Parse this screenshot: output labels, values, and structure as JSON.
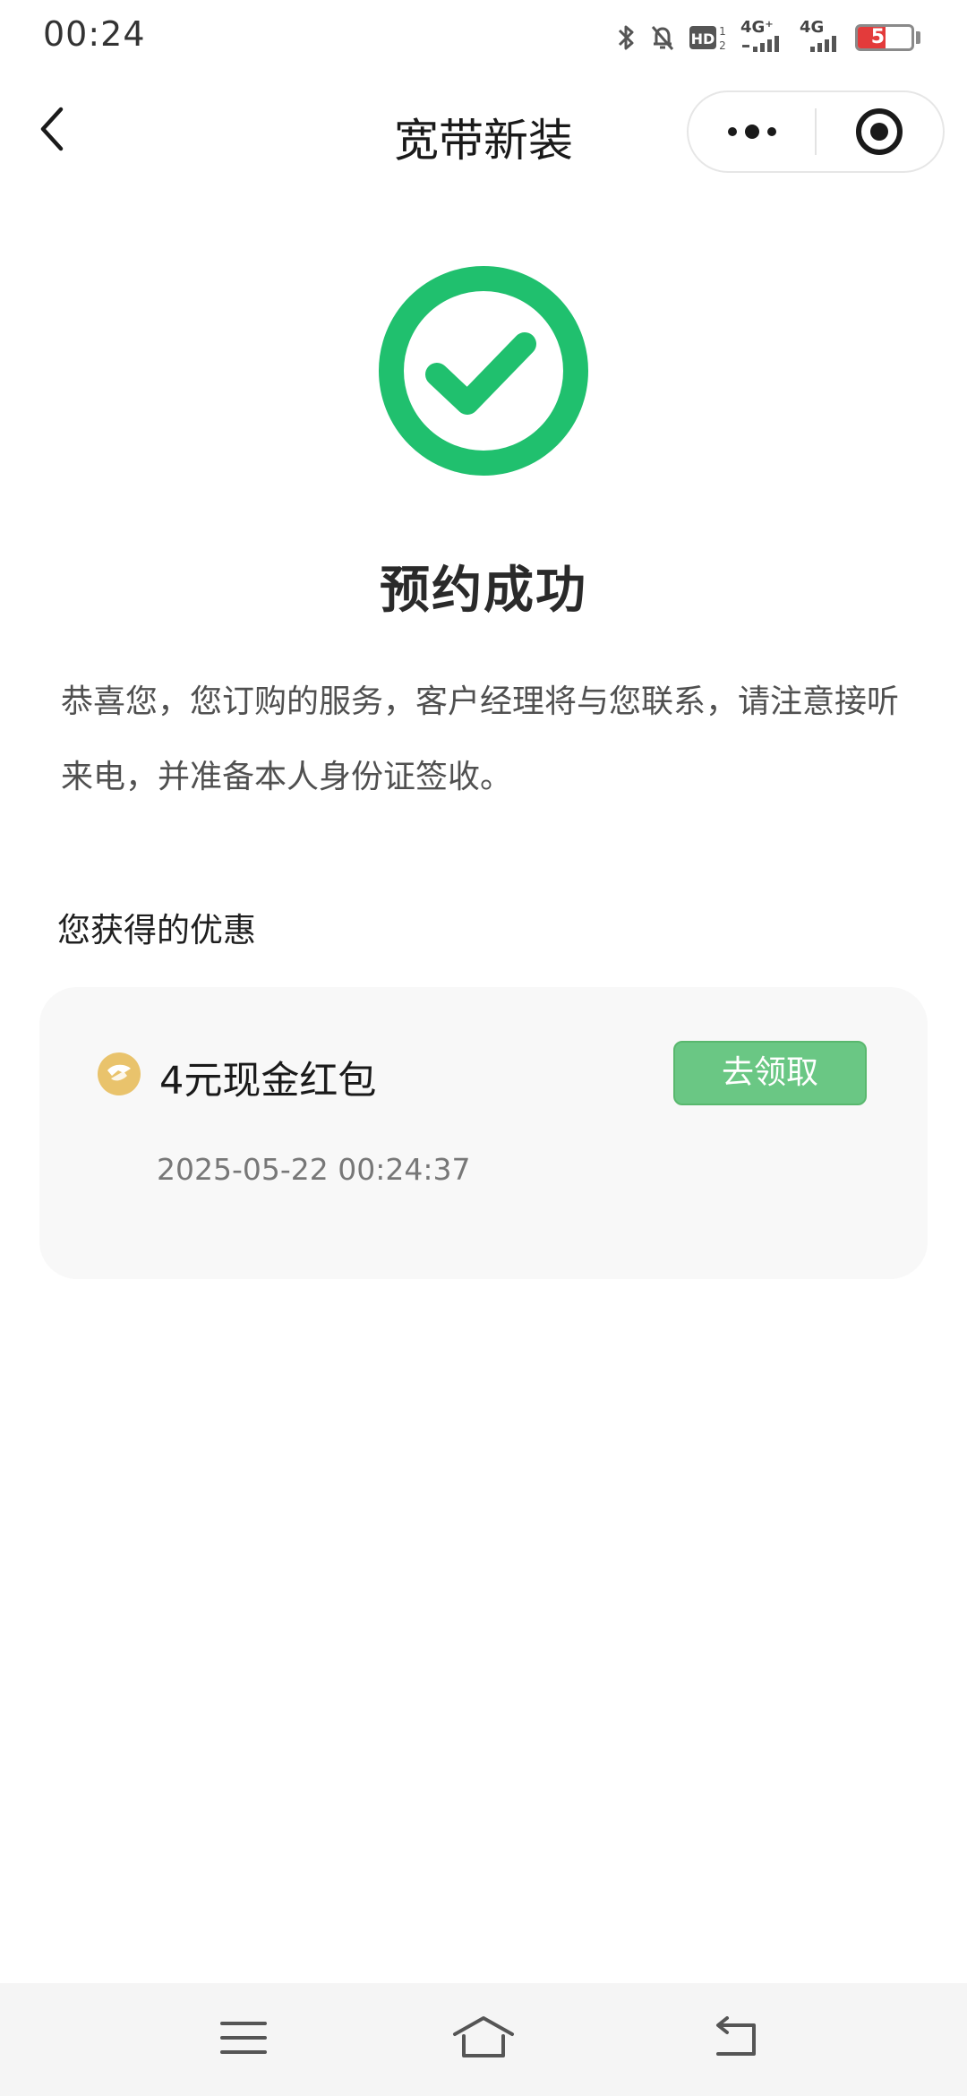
{
  "status_bar": {
    "time": "00:24",
    "battery_level": "51",
    "network_label_1": "4G⁺",
    "network_label_2": "4G",
    "hd_label": "HD"
  },
  "nav": {
    "title": "宽带新装"
  },
  "success": {
    "title": "预约成功",
    "description": "恭喜您，您订购的服务，客户经理将与您联系，请注意接听来电，并准备本人身份证签收。"
  },
  "benefits": {
    "heading": "您获得的优惠",
    "coupon": {
      "title": "4元现金红包",
      "claim_label": "去领取",
      "date": "2025-05-22 00:24:37"
    }
  },
  "colors": {
    "success_green": "#20c06e",
    "claim_button": "#6ac784",
    "coupon_icon": "#e9c36c",
    "battery_red": "#e33b3b"
  },
  "icons": {
    "back": "chevron-left-icon",
    "more": "more-dots-icon",
    "close": "target-circle-icon",
    "success": "check-circle-icon",
    "coupon": "red-packet-icon",
    "menu": "menu-lines-icon",
    "home": "home-icon",
    "return": "return-arrow-icon"
  }
}
